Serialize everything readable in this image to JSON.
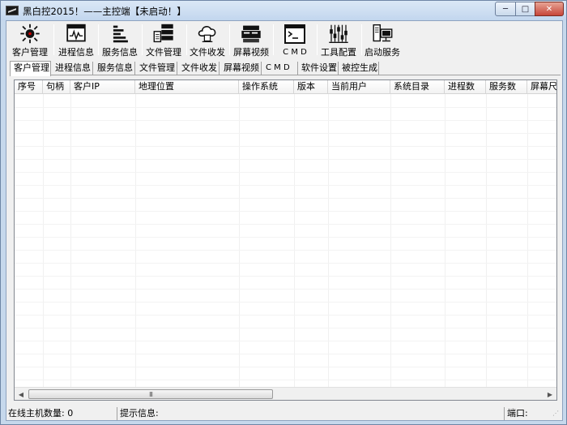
{
  "window": {
    "title": "黑白控2015！——主控端【未启动！】",
    "min_glyph": "─",
    "max_glyph": "□",
    "close_glyph": "✕"
  },
  "toolbar": [
    {
      "label": "客户管理",
      "icon": "client-manage-icon"
    },
    {
      "label": "进程信息",
      "icon": "process-info-icon"
    },
    {
      "label": "服务信息",
      "icon": "service-info-icon"
    },
    {
      "label": "文件管理",
      "icon": "file-manage-icon"
    },
    {
      "label": "文件收发",
      "icon": "file-transfer-icon"
    },
    {
      "label": "屏幕视频",
      "icon": "screen-video-icon"
    },
    {
      "label": "C M D",
      "icon": "cmd-icon"
    },
    {
      "label": "工具配置",
      "icon": "tool-config-icon"
    },
    {
      "label": "启动服务",
      "icon": "start-service-icon"
    }
  ],
  "tabs": [
    {
      "label": "客户管理",
      "active": true
    },
    {
      "label": "进程信息",
      "active": false
    },
    {
      "label": "服务信息",
      "active": false
    },
    {
      "label": "文件管理",
      "active": false
    },
    {
      "label": "文件收发",
      "active": false
    },
    {
      "label": "屏幕视频",
      "active": false
    },
    {
      "label": "C M D",
      "active": false
    },
    {
      "label": "软件设置",
      "active": false
    },
    {
      "label": "被控生成",
      "active": false
    }
  ],
  "list": {
    "columns": [
      "序号",
      "句柄",
      "客户IP",
      "地理位置",
      "操作系统",
      "版本",
      "当前用户",
      "系统目录",
      "进程数",
      "服务数",
      "屏幕尺"
    ],
    "rows": []
  },
  "scrollbar": {
    "left_arrow": "◀",
    "right_arrow": "▶",
    "thumb_grip": "III"
  },
  "statusbar": {
    "online_count": "在线主机数量: 0",
    "hint": "提示信息:",
    "port": "端口:"
  },
  "colors": {
    "frame": "#c6d8ec",
    "close_button": "#c6463a"
  }
}
